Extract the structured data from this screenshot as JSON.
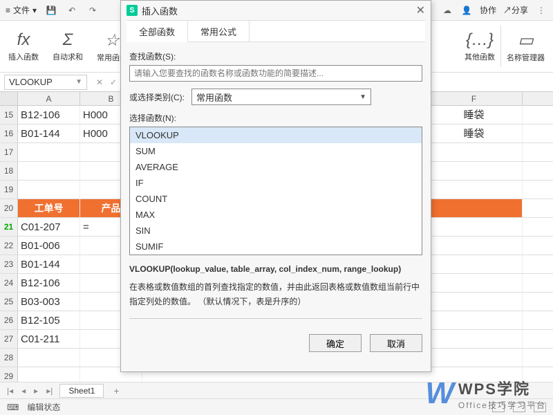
{
  "top": {
    "file": "文件",
    "collab": "协作",
    "share": "分享"
  },
  "ribbon": {
    "insertFunc": {
      "label": "插入函数",
      "icon": "fx"
    },
    "autoSum": {
      "label": "自动求和",
      "icon": "Σ"
    },
    "common": {
      "label": "常用函数",
      "icon": "☆"
    },
    "other": {
      "label": "其他函数",
      "icon": "›"
    },
    "nameMgr": {
      "label": "名称管理器",
      "icon": "▭"
    }
  },
  "nameBox": "VLOOKUP",
  "columns": [
    "A",
    "B",
    "F"
  ],
  "rows": [
    {
      "n": "15",
      "a": "B12-106",
      "b": "H000",
      "f": "睡袋"
    },
    {
      "n": "16",
      "a": "B01-144",
      "b": "H000",
      "f": "睡袋"
    },
    {
      "n": "17"
    },
    {
      "n": "18"
    },
    {
      "n": "19"
    },
    {
      "n": "20",
      "header": true,
      "a": "工单号",
      "b": "产品"
    },
    {
      "n": "21",
      "active": true,
      "a": "C01-207",
      "b": "="
    },
    {
      "n": "22",
      "a": "B01-006"
    },
    {
      "n": "23",
      "a": "B01-144"
    },
    {
      "n": "24",
      "a": "B12-106"
    },
    {
      "n": "25",
      "a": "B03-003"
    },
    {
      "n": "26",
      "a": "B12-105"
    },
    {
      "n": "27",
      "a": "C01-211"
    },
    {
      "n": "28"
    },
    {
      "n": "29"
    }
  ],
  "sheetTab": "Sheet1",
  "statusText": "编辑状态",
  "dialog": {
    "title": "插入函数",
    "tabs": [
      "全部函数",
      "常用公式"
    ],
    "searchLabel": "查找函数(S):",
    "searchPlaceholder": "请输入您要查找的函数名称或函数功能的简要描述...",
    "categoryLabel": "或选择类别(C):",
    "categoryValue": "常用函数",
    "selectLabel": "选择函数(N):",
    "functions": [
      "VLOOKUP",
      "SUM",
      "AVERAGE",
      "IF",
      "COUNT",
      "MAX",
      "SIN",
      "SUMIF"
    ],
    "signature": "VLOOKUP(lookup_value, table_array, col_index_num, range_lookup)",
    "description": "在表格或数值数组的首列查找指定的数值，并由此返回表格或数值数组当前行中指定列处的数值。 （默认情况下，表是升序的）",
    "ok": "确定",
    "cancel": "取消"
  },
  "watermark": {
    "brand": "WPS学院",
    "sub": "Office技巧学习平台"
  }
}
